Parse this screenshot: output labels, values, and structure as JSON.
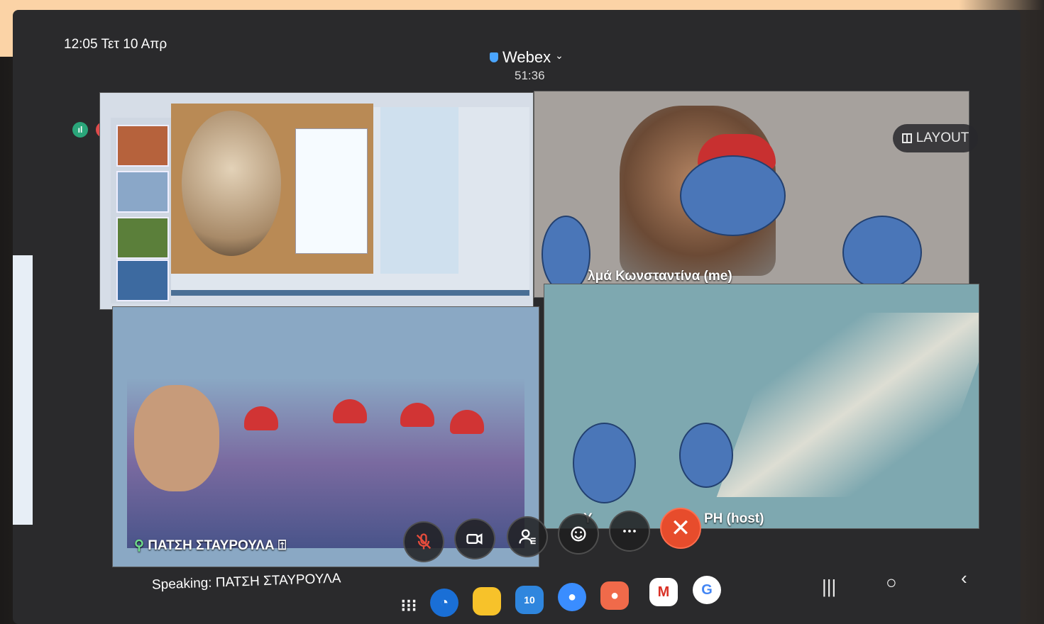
{
  "status_bar": {
    "time_date": "12:05 Τετ 10 Απρ"
  },
  "meeting": {
    "app_name": "Webex",
    "elapsed": "51:36"
  },
  "layout_button": {
    "label": "LAYOUT"
  },
  "participants": {
    "self_name": "λμά Κωνσταντίνα (me)",
    "classroom_name": "ΠΑΤΣΗ ΣΤΑΥΡΟΥΛΑ",
    "host_name_left": "Υ",
    "host_name_right": "ΡΗ (host)"
  },
  "speaking_label": "Speaking: ΠΑΤΣΗ ΣΤΑΥΡΟΥΛΑ",
  "controls": [
    {
      "name": "mute",
      "icon": "mic-off-icon"
    },
    {
      "name": "video",
      "icon": "camera-icon"
    },
    {
      "name": "participants",
      "icon": "participants-icon"
    },
    {
      "name": "reactions",
      "icon": "emoji-icon"
    },
    {
      "name": "more",
      "icon": "more-icon"
    },
    {
      "name": "leave",
      "icon": "close-icon"
    }
  ],
  "dock": {
    "calendar_day": "10",
    "icons": [
      "apps-grid-icon",
      "internet-icon",
      "files-icon",
      "calendar-icon",
      "messages-icon",
      "contacts-icon",
      "gmail-icon",
      "google-icon"
    ]
  },
  "colors": {
    "accent": "#e74c2c",
    "webex_shield": "#4aa5ff",
    "redaction": "#4a76b8"
  }
}
